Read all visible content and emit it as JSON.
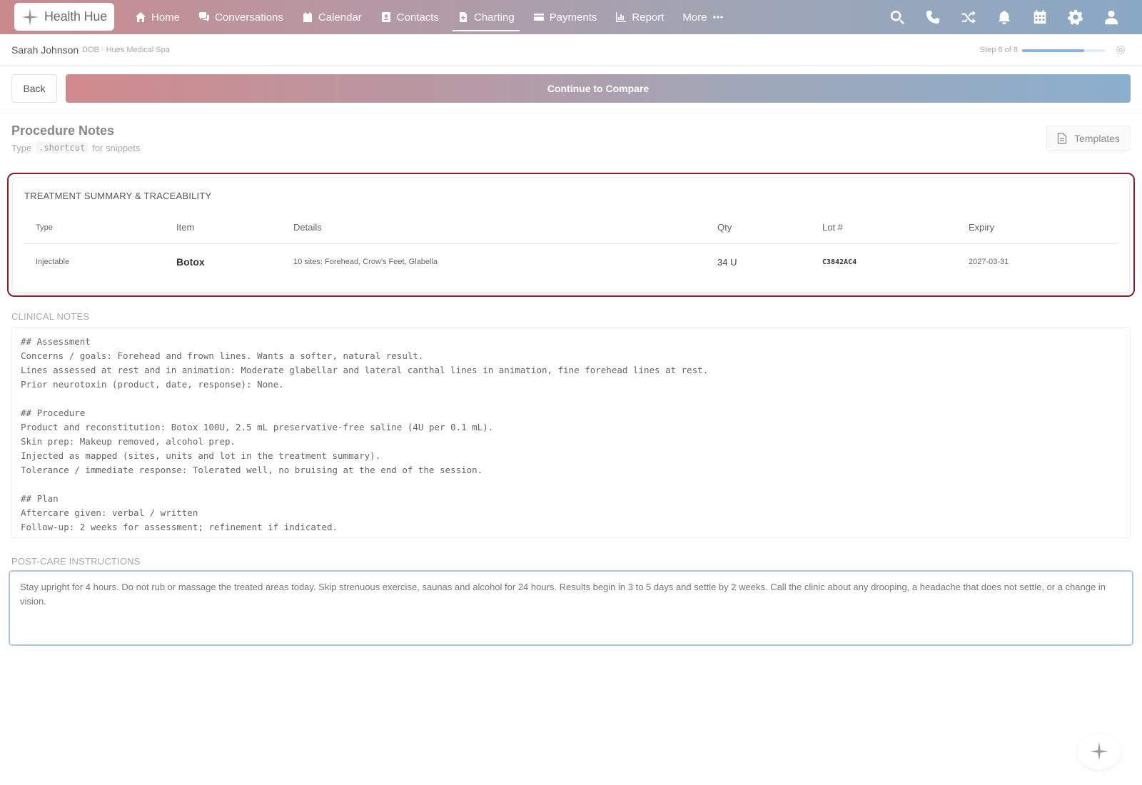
{
  "brand": {
    "name": "Health Hue"
  },
  "nav": {
    "items": [
      {
        "label": "Home",
        "icon": "home-icon",
        "active": false
      },
      {
        "label": "Conversations",
        "icon": "chat-icon",
        "active": false
      },
      {
        "label": "Calendar",
        "icon": "calendar-icon",
        "active": false
      },
      {
        "label": "Contacts",
        "icon": "contact-card-icon",
        "active": false
      },
      {
        "label": "Charting",
        "icon": "document-icon",
        "active": true
      },
      {
        "label": "Payments",
        "icon": "credit-card-icon",
        "active": false
      },
      {
        "label": "Report",
        "icon": "bar-chart-icon",
        "active": false
      },
      {
        "label": "More",
        "icon": "ellipsis-icon",
        "active": false
      }
    ],
    "right_icons": [
      "search-icon",
      "phone-icon",
      "shuffle-icon",
      "bell-icon",
      "calendar-grid-icon",
      "gear-icon",
      "user-icon"
    ]
  },
  "patient": {
    "name": "Sarah Johnson",
    "meta": "DOB · Hues Medical Spa",
    "step_text": "Step 6 of 8",
    "step_progress": 0.75
  },
  "actions": {
    "back_label": "Back",
    "continue_label": "Continue to Compare"
  },
  "procedure": {
    "title": "Procedure Notes",
    "hint_prefix": "Type",
    "hint_code": ".shortcut",
    "hint_suffix": "for snippets",
    "templates_label": "Templates"
  },
  "summary": {
    "title": "TREATMENT SUMMARY & TRACEABILITY",
    "headers": {
      "type": "Type",
      "item": "Item",
      "details": "Details",
      "qty": "Qty",
      "lot": "Lot #",
      "expiry": "Expiry"
    },
    "rows": [
      {
        "type": "Injectable",
        "item": "Botox",
        "details": "10 sites: Forehead, Crow's Feet, Glabella",
        "qty": "34 U",
        "lot": "C3842AC4",
        "expiry": "2027-03-31"
      }
    ]
  },
  "clinical_notes": {
    "label": "CLINICAL NOTES",
    "value": "## Assessment\nConcerns / goals: Forehead and frown lines. Wants a softer, natural result.\nLines assessed at rest and in animation: Moderate glabellar and lateral canthal lines in animation, fine forehead lines at rest.\nPrior neurotoxin (product, date, response): None.\n\n## Procedure\nProduct and reconstitution: Botox 100U, 2.5 mL preservative-free saline (4U per 0.1 mL).\nSkin prep: Makeup removed, alcohol prep.\nInjected as mapped (sites, units and lot in the treatment summary).\nTolerance / immediate response: Tolerated well, no bruising at the end of the session.\n\n## Plan\nAftercare given: verbal / written\nFollow-up: 2 weeks for assessment; refinement if indicated."
  },
  "post_care": {
    "label": "POST-CARE INSTRUCTIONS",
    "value": "Stay upright for 4 hours. Do not rub or massage the treated areas today. Skip strenuous exercise, saunas and alcohol for 24 hours. Results begin in 3 to 5 days and settle by 2 weeks. Call the clinic about any drooping, a headache that does not settle, or a change in vision."
  },
  "colors": {
    "accent_border": "#8b1e2e",
    "focus_border": "#a9c8e6",
    "nav_gradient_start": "#c98a8e",
    "nav_gradient_end": "#8aa9c6"
  }
}
